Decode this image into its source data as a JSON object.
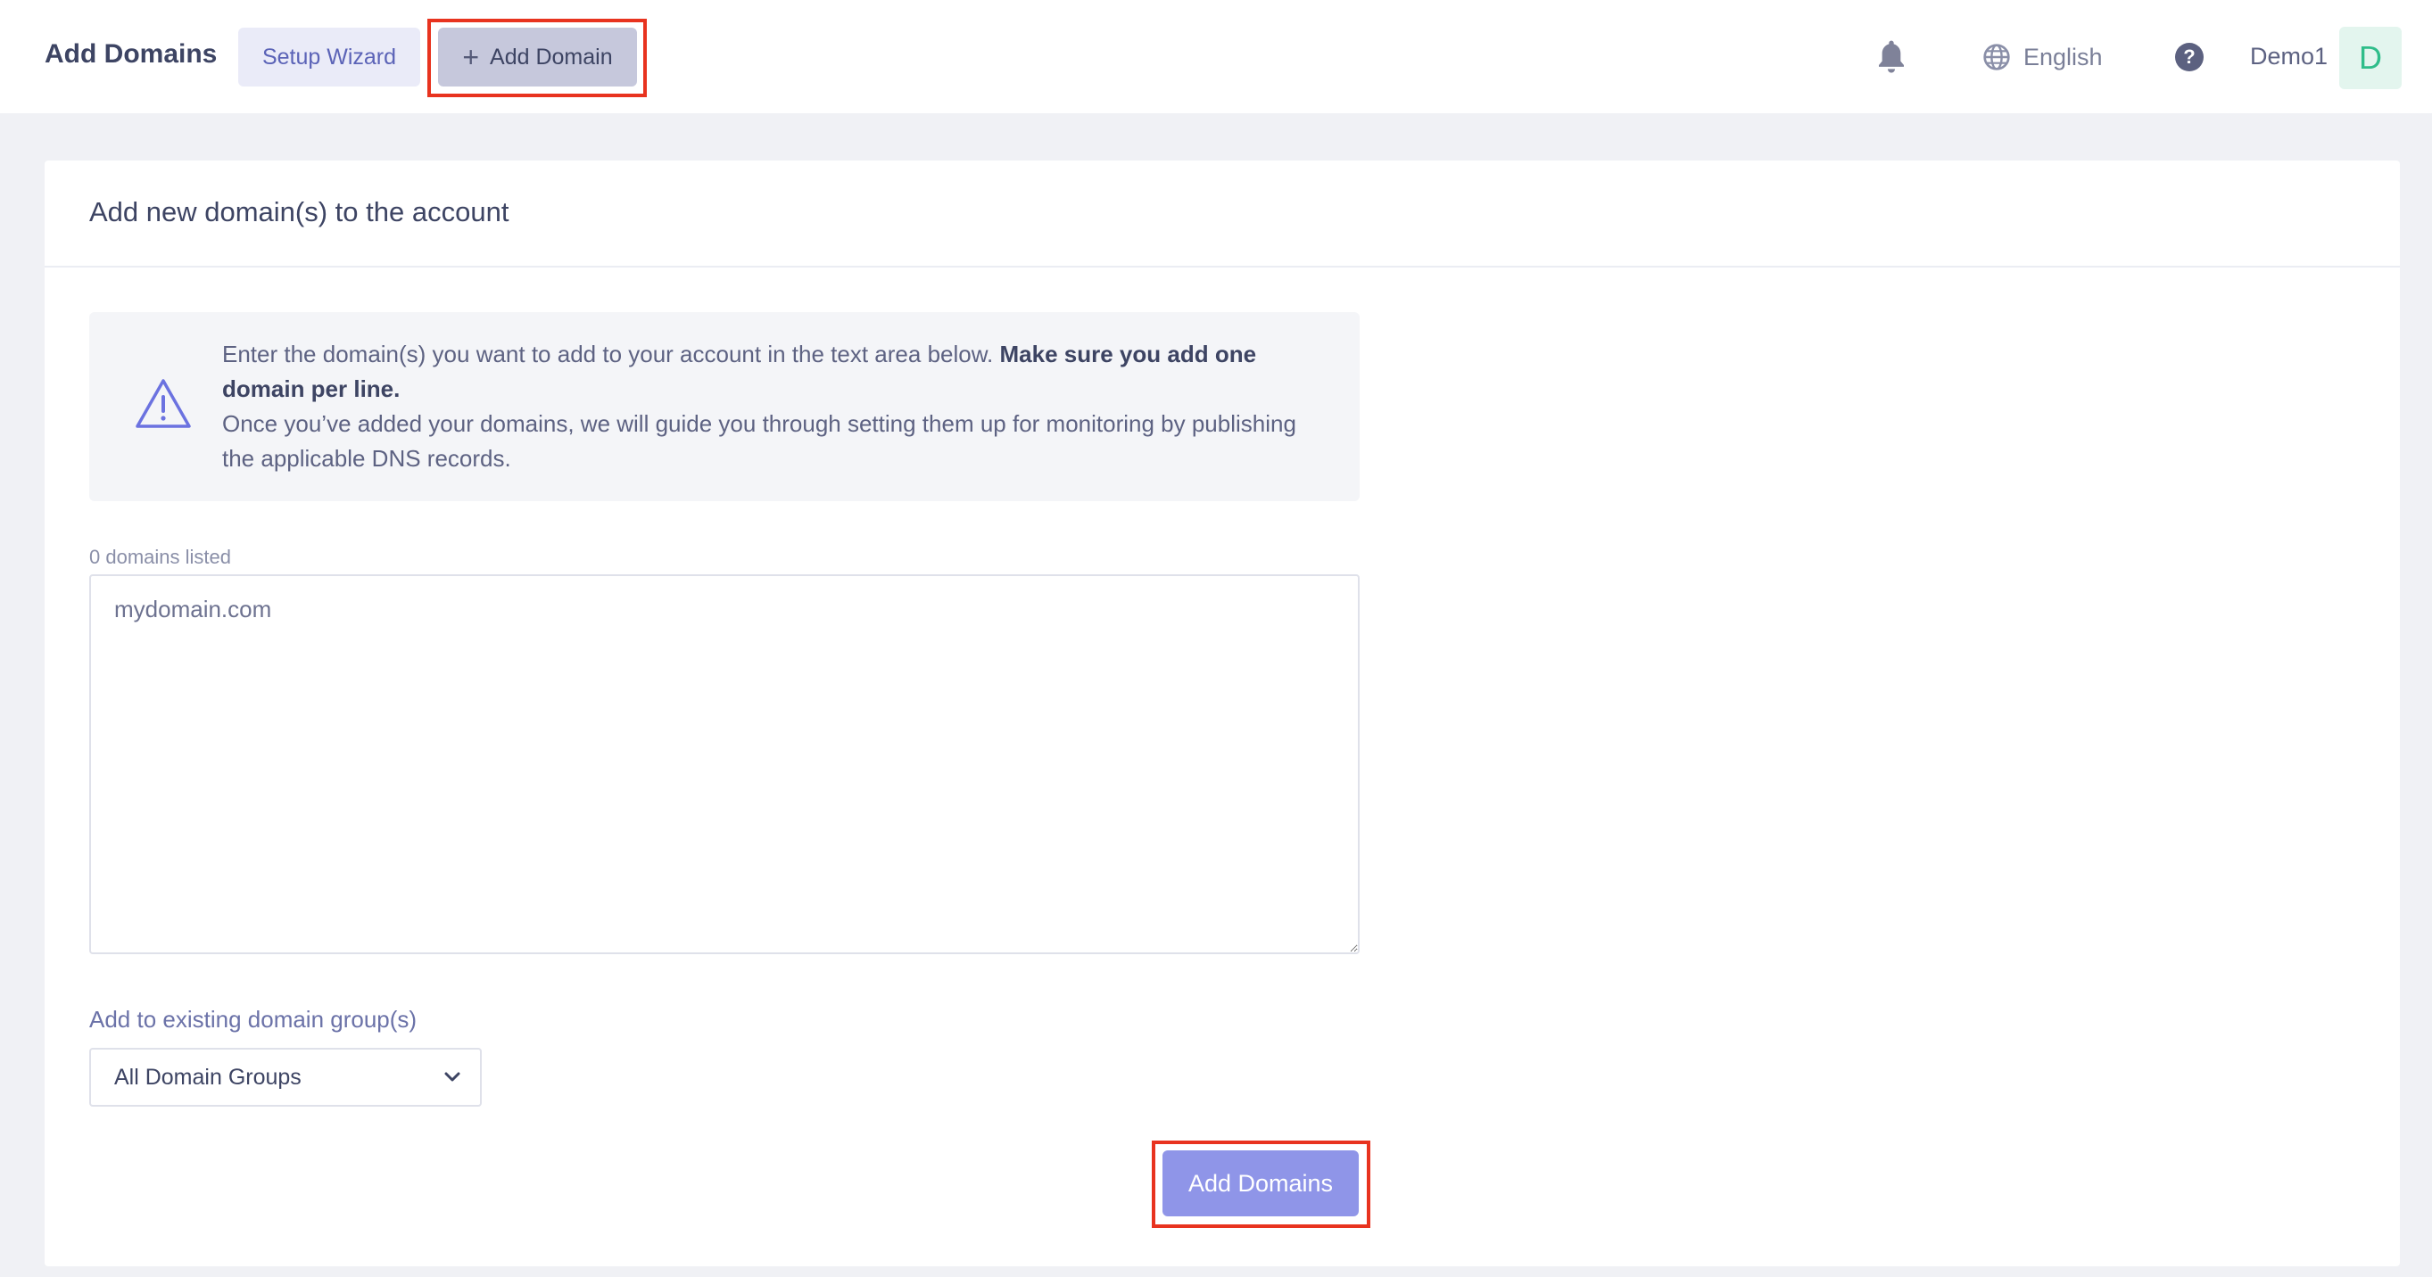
{
  "header": {
    "title": "Add Domains",
    "setup_wizard_label": "Setup Wizard",
    "add_domain_label": "Add Domain",
    "language": "English",
    "username": "Demo1",
    "avatar_initial": "D"
  },
  "card": {
    "title": "Add new domain(s) to the account",
    "notice": {
      "text_intro": "Enter the domain(s) you want to add to your account in the text area below. ",
      "text_bold": "Make sure you add one domain per line.",
      "text_follow": "Once you’ve added your domains, we will guide you through setting them up for monitoring by publishing the applicable DNS records."
    },
    "domain_count": "0 domains listed",
    "textarea_placeholder": "mydomain.com",
    "group_label": "Add to existing domain group(s)",
    "group_select_value": "All Domain Groups",
    "submit_label": "Add Domains"
  },
  "colors": {
    "highlight": "#e8331f",
    "submit": "#8f95e8",
    "avatar": "#2fbd8a"
  },
  "icons": [
    "bell-icon",
    "globe-icon",
    "help-icon",
    "warning-icon",
    "chevron-down-icon",
    "plus-icon"
  ]
}
